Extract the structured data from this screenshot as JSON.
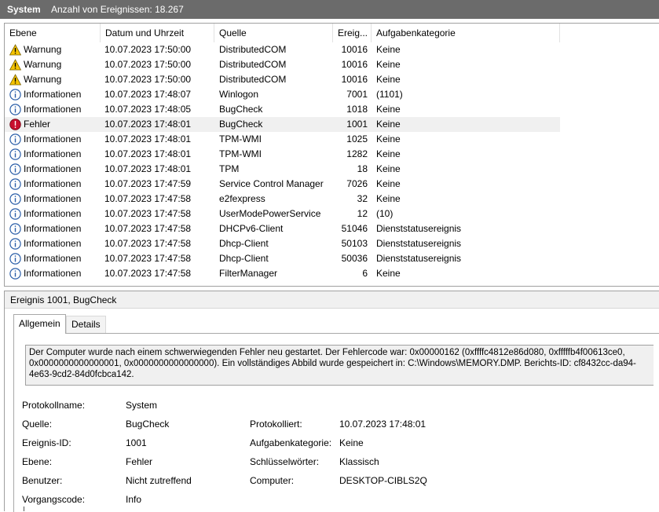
{
  "titlebar": {
    "log_name": "System",
    "event_count_text": "Anzahl von Ereignissen: 18.267"
  },
  "colors": {
    "warning": "#f5c400",
    "info": "#2a5ea8",
    "error": "#c8102e",
    "titlebar": "#6b6b6b"
  },
  "columns": [
    "Ebene",
    "Datum und Uhrzeit",
    "Quelle",
    "Ereig...",
    "Aufgabenkategorie"
  ],
  "events": [
    {
      "icon": "warning-icon",
      "level": "Warnung",
      "datetime": "10.07.2023 17:50:00",
      "source": "DistributedCOM",
      "id": "10016",
      "category": "Keine"
    },
    {
      "icon": "warning-icon",
      "level": "Warnung",
      "datetime": "10.07.2023 17:50:00",
      "source": "DistributedCOM",
      "id": "10016",
      "category": "Keine"
    },
    {
      "icon": "warning-icon",
      "level": "Warnung",
      "datetime": "10.07.2023 17:50:00",
      "source": "DistributedCOM",
      "id": "10016",
      "category": "Keine"
    },
    {
      "icon": "info-icon",
      "level": "Informationen",
      "datetime": "10.07.2023 17:48:07",
      "source": "Winlogon",
      "id": "7001",
      "category": "(1101)"
    },
    {
      "icon": "info-icon",
      "level": "Informationen",
      "datetime": "10.07.2023 17:48:05",
      "source": "BugCheck",
      "id": "1018",
      "category": "Keine"
    },
    {
      "icon": "error-icon",
      "level": "Fehler",
      "datetime": "10.07.2023 17:48:01",
      "source": "BugCheck",
      "id": "1001",
      "category": "Keine",
      "selected": true
    },
    {
      "icon": "info-icon",
      "level": "Informationen",
      "datetime": "10.07.2023 17:48:01",
      "source": "TPM-WMI",
      "id": "1025",
      "category": "Keine"
    },
    {
      "icon": "info-icon",
      "level": "Informationen",
      "datetime": "10.07.2023 17:48:01",
      "source": "TPM-WMI",
      "id": "1282",
      "category": "Keine"
    },
    {
      "icon": "info-icon",
      "level": "Informationen",
      "datetime": "10.07.2023 17:48:01",
      "source": "TPM",
      "id": "18",
      "category": "Keine"
    },
    {
      "icon": "info-icon",
      "level": "Informationen",
      "datetime": "10.07.2023 17:47:59",
      "source": "Service Control Manager",
      "id": "7026",
      "category": "Keine"
    },
    {
      "icon": "info-icon",
      "level": "Informationen",
      "datetime": "10.07.2023 17:47:58",
      "source": "e2fexpress",
      "id": "32",
      "category": "Keine"
    },
    {
      "icon": "info-icon",
      "level": "Informationen",
      "datetime": "10.07.2023 17:47:58",
      "source": "UserModePowerService",
      "id": "12",
      "category": "(10)"
    },
    {
      "icon": "info-icon",
      "level": "Informationen",
      "datetime": "10.07.2023 17:47:58",
      "source": "DHCPv6-Client",
      "id": "51046",
      "category": "Dienststatusereignis"
    },
    {
      "icon": "info-icon",
      "level": "Informationen",
      "datetime": "10.07.2023 17:47:58",
      "source": "Dhcp-Client",
      "id": "50103",
      "category": "Dienststatusereignis"
    },
    {
      "icon": "info-icon",
      "level": "Informationen",
      "datetime": "10.07.2023 17:47:58",
      "source": "Dhcp-Client",
      "id": "50036",
      "category": "Dienststatusereignis"
    },
    {
      "icon": "info-icon",
      "level": "Informationen",
      "datetime": "10.07.2023 17:47:58",
      "source": "FilterManager",
      "id": "6",
      "category": "Keine"
    }
  ],
  "detail": {
    "title": "Ereignis 1001, BugCheck",
    "tabs": [
      "Allgemein",
      "Details"
    ],
    "description": "Der Computer wurde nach einem schwerwiegenden Fehler neu gestartet. Der Fehlercode war: 0x00000162 (0xffffc4812e86d080, 0xfffffb4f00613ce0, 0x0000000000000001, 0x0000000000000000). Ein vollständiges Abbild wurde gespeichert in: C:\\Windows\\MEMORY.DMP. Berichts-ID: cf8432cc-da94-4e63-9cd2-84d0fcbca142.",
    "fields": {
      "protokollname": {
        "label": "Protokollname:",
        "value": "System"
      },
      "quelle": {
        "label": "Quelle:",
        "value": "BugCheck"
      },
      "protokolliert": {
        "label": "Protokolliert:",
        "value": "10.07.2023 17:48:01"
      },
      "ereignis_id": {
        "label": "Ereignis-ID:",
        "value": "1001"
      },
      "aufgabenkategorie": {
        "label": "Aufgabenkategorie:",
        "value": "Keine"
      },
      "ebene": {
        "label": "Ebene:",
        "value": "Fehler"
      },
      "schluesselwoerter": {
        "label": "Schlüsselwörter:",
        "value": "Klassisch"
      },
      "benutzer": {
        "label": "Benutzer:",
        "value": "Nicht zutreffend"
      },
      "computer": {
        "label": "Computer:",
        "value": "DESKTOP-CIBLS2Q"
      },
      "vorgangscode": {
        "label": "Vorgangscode:",
        "value": "Info"
      }
    }
  }
}
